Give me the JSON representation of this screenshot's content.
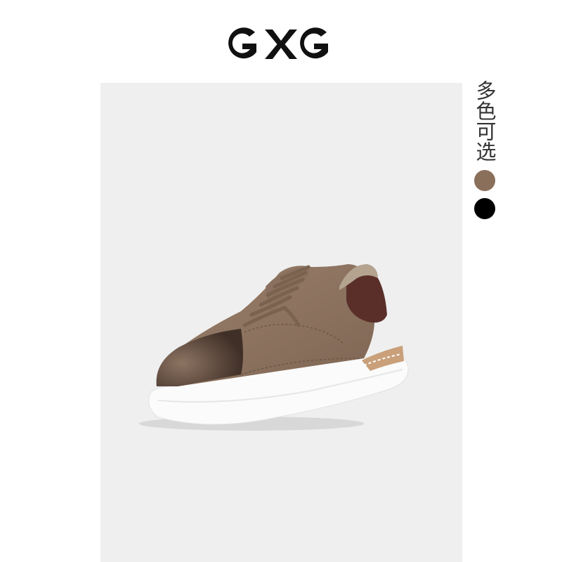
{
  "brand": {
    "logo_text": "GXG"
  },
  "product": {
    "image": "brown-leather-sneaker"
  },
  "color_options": {
    "label": "多色可选",
    "swatches": [
      {
        "name": "brown",
        "color": "#8a6f5b"
      },
      {
        "name": "black",
        "color": "#000000"
      }
    ]
  }
}
